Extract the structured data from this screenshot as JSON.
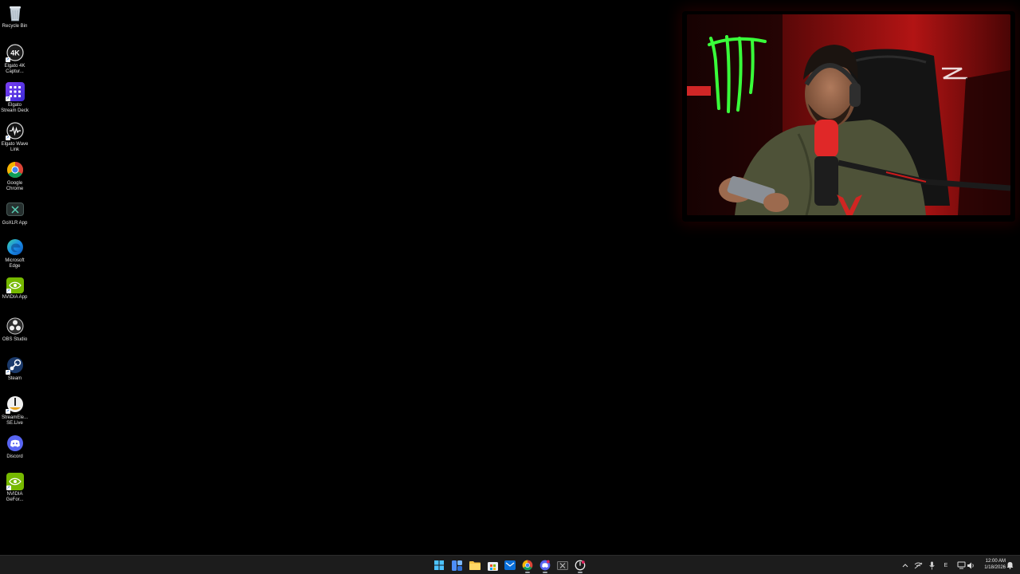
{
  "desktop": {
    "icons": [
      {
        "label": "Recycle Bin",
        "icon": "recycle-bin-icon"
      },
      {
        "label": "Elgato 4K Captur...",
        "icon": "elgato-4k-icon",
        "badge": "4K"
      },
      {
        "label": "Elgato Stream Deck",
        "icon": "stream-deck-icon"
      },
      {
        "label": "Elgato Wave Link",
        "icon": "wave-link-icon"
      },
      {
        "label": "Google Chrome",
        "icon": "chrome-icon"
      },
      {
        "label": "GoXLR App",
        "icon": "goxlr-icon"
      },
      {
        "label": "Microsoft Edge",
        "icon": "edge-icon"
      },
      {
        "label": "NVIDIA App",
        "icon": "nvidia-icon"
      },
      {
        "label": "OBS Studio",
        "icon": "obs-icon"
      },
      {
        "label": "Steam",
        "icon": "steam-icon"
      },
      {
        "label": "StreamEle... SE.Live",
        "icon": "streamelements-icon"
      },
      {
        "label": "Discord",
        "icon": "discord-icon"
      },
      {
        "label": "NVIDIA GeFor...",
        "icon": "nvidia-geforce-icon"
      }
    ]
  },
  "webcam": {
    "description_icon": "webcam-feed",
    "accent_color": "#cc1a1a",
    "logo_color": "#39ff3a"
  },
  "taskbar": {
    "apps": [
      {
        "name": "start-button",
        "icon": "windows-icon"
      },
      {
        "name": "taskbar-widgets",
        "icon": "widgets-icon"
      },
      {
        "name": "taskbar-file-explorer",
        "icon": "folder-icon"
      },
      {
        "name": "taskbar-store",
        "icon": "store-icon"
      },
      {
        "name": "taskbar-outlook",
        "icon": "mail-icon"
      },
      {
        "name": "taskbar-chrome",
        "icon": "chrome-icon"
      },
      {
        "name": "taskbar-discord",
        "icon": "discord-icon"
      },
      {
        "name": "taskbar-goxlr",
        "icon": "goxlr-icon"
      },
      {
        "name": "taskbar-streamelements",
        "icon": "streamelements-icon"
      }
    ],
    "tray": {
      "lang": "E",
      "time": "12:00 AM",
      "date": "1/18/2026"
    }
  }
}
